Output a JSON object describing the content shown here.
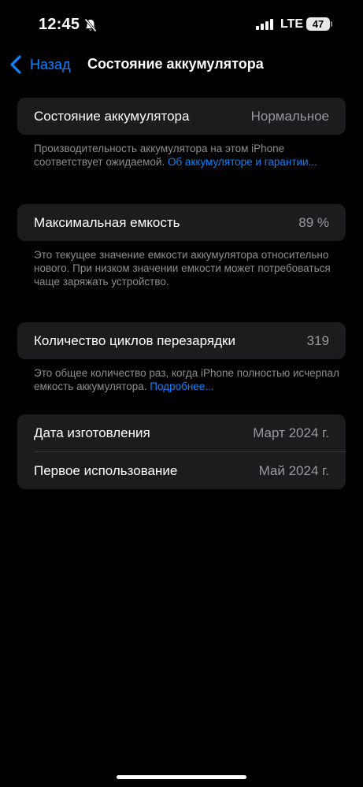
{
  "status_bar": {
    "time": "12:45",
    "network": "LTE",
    "battery_level": "47",
    "icons": [
      "bell-slash-icon",
      "cellular-signal-icon",
      "battery-icon"
    ]
  },
  "nav": {
    "back_label": "Назад",
    "title": "Состояние аккумулятора"
  },
  "health": {
    "label": "Состояние аккумулятора",
    "value": "Нормальное",
    "note": "Производительность аккумулятора на этом iPhone соответствует ожидаемой. ",
    "link": "Об аккумуляторе и гарантии..."
  },
  "capacity": {
    "label": "Максимальная емкость",
    "value": "89 %",
    "note": "Это текущее значение емкости аккумулятора относительно нового. При низком значении емкости может потребоваться чаще заряжать устройство."
  },
  "cycles": {
    "label": "Количество циклов перезарядки",
    "value": "319",
    "note": "Это общее количество раз, когда iPhone полностью исчерпал емкость аккумулятора. ",
    "link": "Подробнее..."
  },
  "dates": {
    "manufacture_label": "Дата изготовления",
    "manufacture_value": "Март 2024 г.",
    "first_use_label": "Первое использование",
    "first_use_value": "Май 2024 г."
  },
  "colors": {
    "background": "#000000",
    "cell": "#1c1c1e",
    "accent": "#0a84ff",
    "secondary_text": "#8e8e93"
  }
}
